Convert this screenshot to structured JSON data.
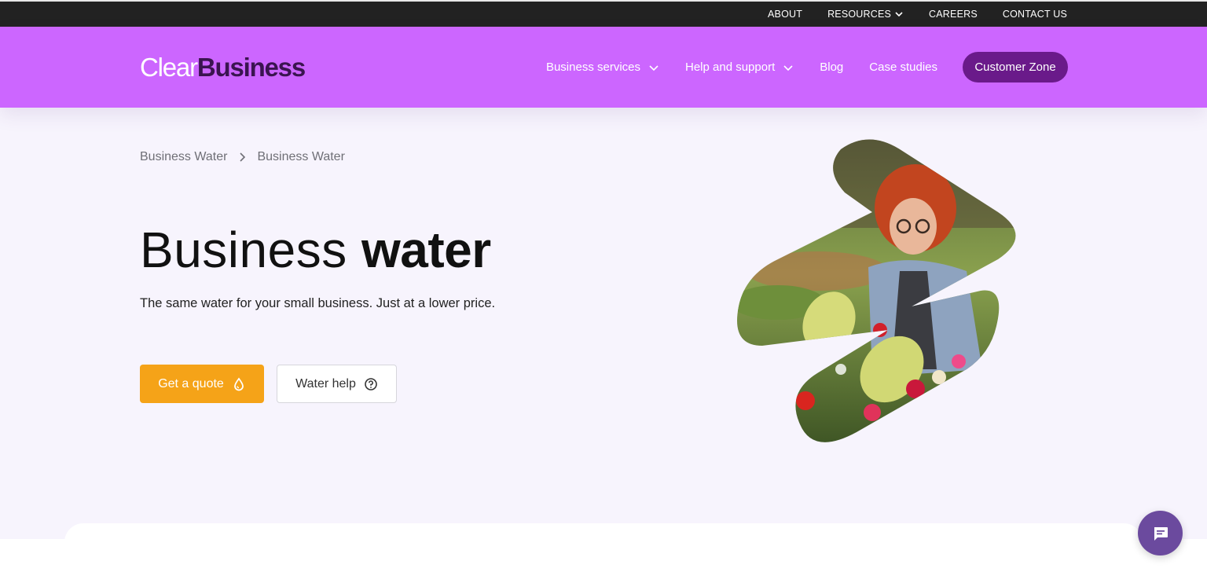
{
  "topbar": {
    "about": "ABOUT",
    "resources": "RESOURCES",
    "careers": "CAREERS",
    "contact": "CONTACT US"
  },
  "header": {
    "logo_part1": "Clear",
    "logo_part2": "Business",
    "nav": {
      "business_services": "Business services",
      "help_support": "Help and support",
      "blog": "Blog",
      "case_studies": "Case studies",
      "customer_zone": "Customer Zone"
    }
  },
  "breadcrumb": {
    "item1": "Business Water",
    "item2": "Business Water"
  },
  "hero": {
    "title_light": "Business",
    "title_bold": "water",
    "subtitle": "The same water for your small business. Just at a lower price.",
    "quote_button": "Get a quote",
    "help_button": "Water help"
  },
  "icons": {
    "resources_dropdown": "chevron-down-icon",
    "nav_dropdown": "chevron-down-icon",
    "breadcrumb_separator": "chevron-right-icon",
    "quote": "water-drop-icon",
    "help": "question-circle-icon",
    "chat": "chat-icon"
  },
  "colors": {
    "topbar_bg": "#222222",
    "header_bg": "#cc66ff",
    "customer_zone_bg": "#6a1a8a",
    "quote_button_bg": "#f5a318",
    "page_bg": "#f7f4fd",
    "chat_button_bg": "#6b4a9e"
  }
}
